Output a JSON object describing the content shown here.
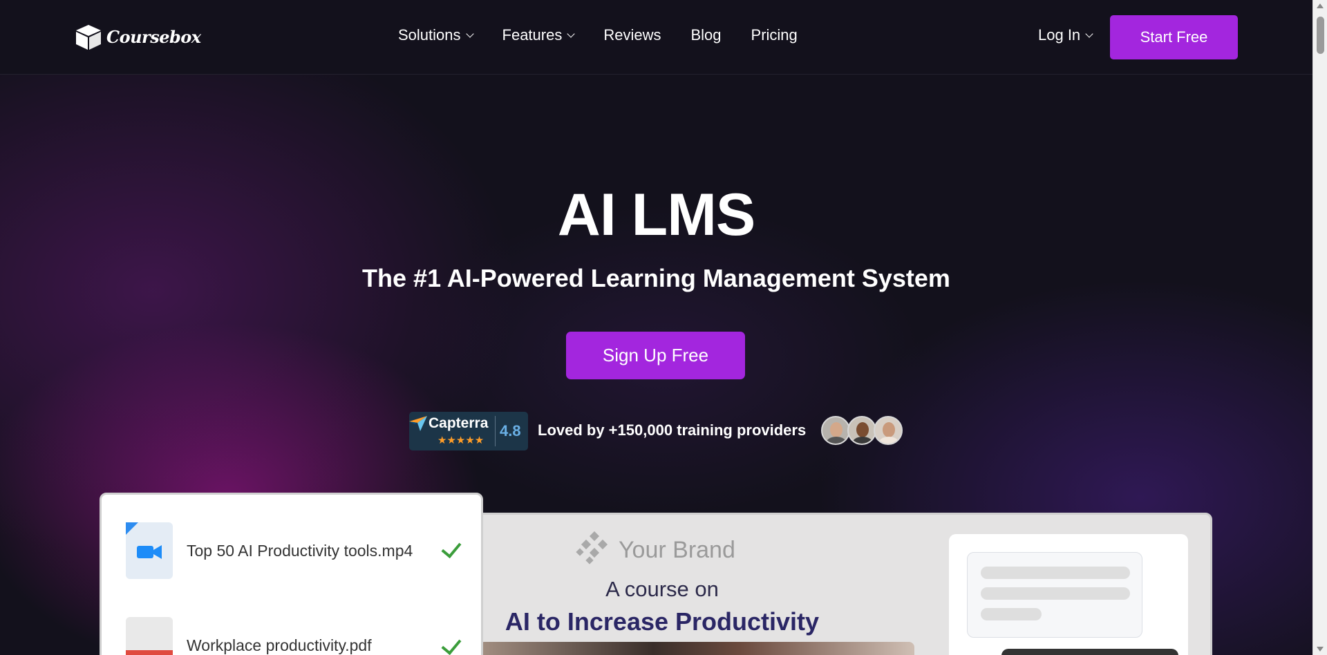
{
  "header": {
    "logo_text": "Coursebox",
    "nav": [
      {
        "label": "Solutions",
        "has_dropdown": true
      },
      {
        "label": "Features",
        "has_dropdown": true
      },
      {
        "label": "Reviews",
        "has_dropdown": false
      },
      {
        "label": "Blog",
        "has_dropdown": false
      },
      {
        "label": "Pricing",
        "has_dropdown": false
      }
    ],
    "login_label": "Log In",
    "start_free_label": "Start Free"
  },
  "hero": {
    "title": "AI LMS",
    "subtitle": "The #1 AI-Powered Learning Management System",
    "signup_label": "Sign Up Free",
    "capterra": {
      "name": "Capterra",
      "stars": "★★★★★",
      "score": "4.8"
    },
    "loved_text": "Loved by +150,000 training providers"
  },
  "upload_card": {
    "files": [
      {
        "name": "Top 50 AI Productivity tools.mp4",
        "type": "video-file-icon"
      },
      {
        "name": "Workplace productivity.pdf",
        "type": "pdf-file-icon"
      }
    ]
  },
  "preview": {
    "brand_text": "Your Brand",
    "course_on": "A course on",
    "course_title": "AI to Increase Productivity"
  },
  "colors": {
    "accent": "#a326de",
    "background": "#13111c",
    "check": "#3b9d3b",
    "capterra_bg": "#1c3548"
  }
}
